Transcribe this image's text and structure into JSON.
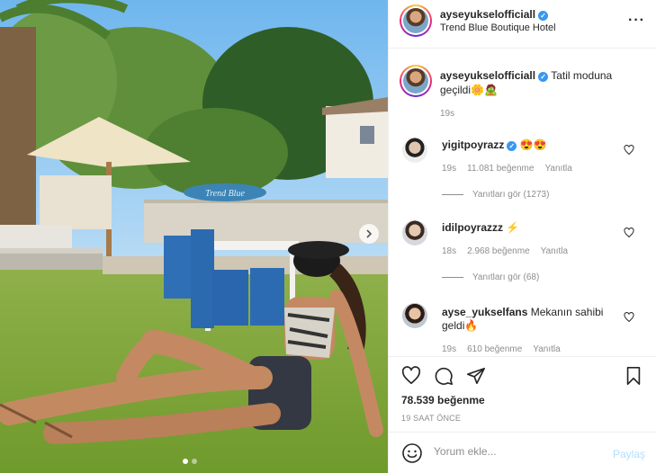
{
  "post": {
    "username": "ayseyukselofficiall",
    "location": "Trend Blue Boutique Hotel",
    "caption": {
      "username": "ayseyukselofficiall",
      "text": "Tatil moduna geçildi🌼🧟",
      "time": "19s"
    },
    "photo": {
      "sign_text": "Trend Blue",
      "carousel_count": 2,
      "carousel_active": 1
    }
  },
  "comments": [
    {
      "username": "yigitpoyrazz",
      "verified": true,
      "text": "😍😍",
      "time": "19s",
      "likes": "11.081 beğenme",
      "reply_label": "Yanıtla",
      "view_replies": "Yanıtları gör (1273)"
    },
    {
      "username": "idilpoyrazzz",
      "verified": false,
      "text": "⚡",
      "time": "18s",
      "likes": "2.968 beğenme",
      "reply_label": "Yanıtla",
      "view_replies": "Yanıtları gör (68)"
    },
    {
      "username": "ayse_yukselfans",
      "verified": false,
      "text": "Mekanın sahibi geldi🔥",
      "time": "19s",
      "likes": "610 beğenme",
      "reply_label": "Yanıtla"
    }
  ],
  "footer": {
    "likes": "78.539 beğenme",
    "posted": "19 SAAT ÖNCE",
    "comment_placeholder": "Yorum ekle...",
    "post_label": "Paylaş"
  },
  "icons": {
    "more": "more-options-icon",
    "like": "heart-icon",
    "comment": "comment-icon",
    "share": "share-icon",
    "save": "bookmark-icon",
    "emoji": "emoji-icon",
    "verified": "verified-badge-icon"
  },
  "colors": {
    "verified": "#3897f0",
    "text": "#262626",
    "muted": "#8e8e8e",
    "post_button_disabled": "#b2dffc"
  }
}
